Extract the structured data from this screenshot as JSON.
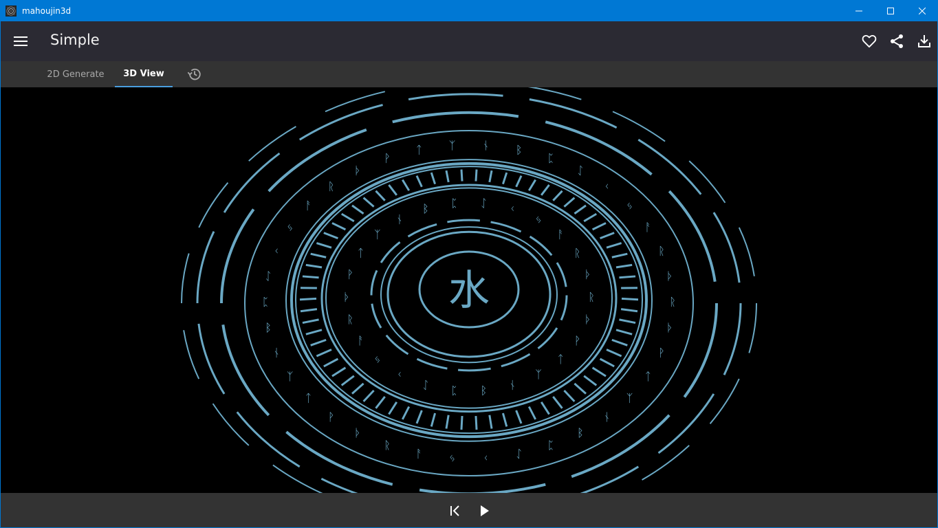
{
  "window": {
    "title": "mahoujin3d",
    "accent_color": "#0078d4"
  },
  "appbar": {
    "title": "Simple",
    "menu_icon": "hamburger-menu-icon",
    "actions": [
      "heart-icon",
      "share-icon",
      "download-icon"
    ]
  },
  "tabs": [
    {
      "label": "2D Generate",
      "active": false
    },
    {
      "label": "3D View",
      "active": true
    },
    {
      "label": "",
      "icon": "history-icon",
      "active": false
    }
  ],
  "viewport": {
    "center_glyph": "水",
    "circle_color": "#6aa8c4",
    "background": "#000000"
  },
  "playback": {
    "controls": [
      "skip-to-start-icon",
      "play-icon"
    ]
  }
}
